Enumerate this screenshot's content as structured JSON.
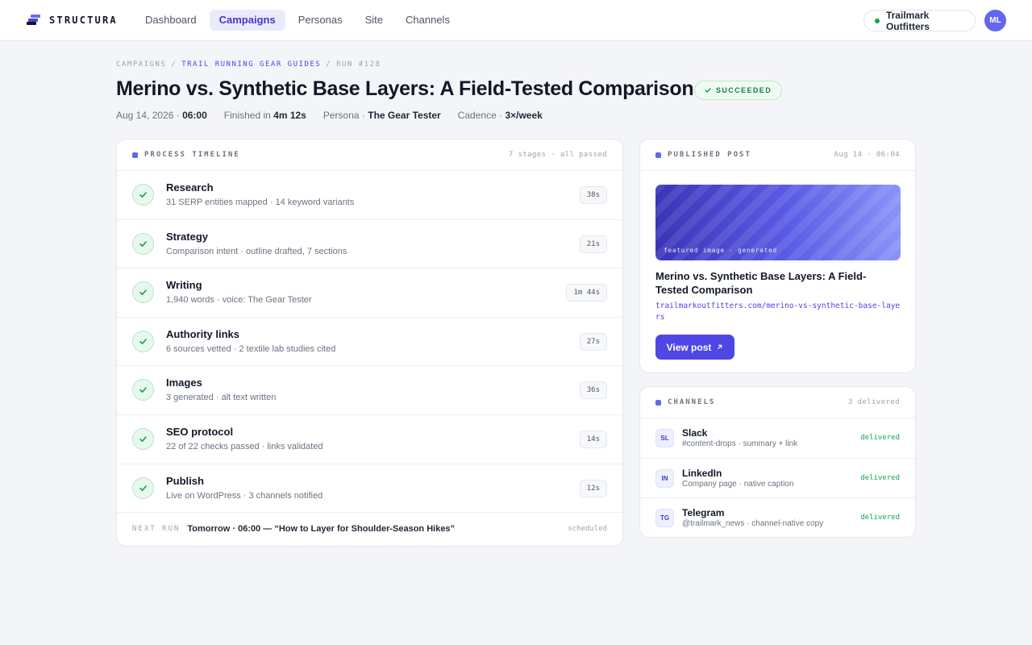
{
  "app": {
    "name": "STRUCTURA"
  },
  "nav": [
    "Dashboard",
    "Campaigns",
    "Personas",
    "Site",
    "Channels"
  ],
  "nav_active": "Campaigns",
  "org": {
    "name": "Trailmark Outfitters"
  },
  "user": {
    "initials": "ML"
  },
  "breadcrumb": {
    "root": "CAMPAIGNS",
    "campaign": "TRAIL RUNNING GEAR GUIDES",
    "run": "RUN #128",
    "sep": "/"
  },
  "title": "Merino vs. Synthetic Base Layers: A Field-Tested Comparison",
  "status": "SUCCEEDED",
  "meta": {
    "date": "Aug 14, 2026 ·",
    "time": "06:00",
    "finished_label": "Finished in",
    "finished_value": "4m 12s",
    "persona_label": "Persona ·",
    "persona_value": "The Gear Tester",
    "cadence_label": "Cadence ·",
    "cadence_value": "3×/week"
  },
  "timeline": {
    "title": "PROCESS TIMELINE",
    "summary": "7 stages · all passed",
    "stages": [
      {
        "name": "Research",
        "detail": "31 SERP entities mapped · 14 keyword variants",
        "duration": "38s"
      },
      {
        "name": "Strategy",
        "detail": "Comparison intent · outline drafted, 7 sections",
        "duration": "21s"
      },
      {
        "name": "Writing",
        "detail": "1,940 words · voice: The Gear Tester",
        "duration": "1m 44s"
      },
      {
        "name": "Authority links",
        "detail": "6 sources vetted · 2 textile lab studies cited",
        "duration": "27s"
      },
      {
        "name": "Images",
        "detail": "3 generated · alt text written",
        "duration": "36s"
      },
      {
        "name": "SEO protocol",
        "detail": "22 of 22 checks passed · links validated",
        "duration": "14s"
      },
      {
        "name": "Publish",
        "detail": "Live on WordPress · 3 channels notified",
        "duration": "12s"
      }
    ],
    "next_run": {
      "label": "NEXT RUN",
      "value": "Tomorrow · 06:00 — “How to Layer for Shoulder-Season Hikes”",
      "status": "scheduled"
    }
  },
  "post": {
    "title": "PUBLISHED POST",
    "timestamp": "Aug 14 · 06:04",
    "image_caption": "featured image · generated",
    "post_title": "Merino vs. Synthetic Base Layers: A Field-Tested Comparison",
    "url": "trailmarkoutfitters.com/merino-vs-synthetic-base-layers",
    "button": "View post"
  },
  "channels": {
    "title": "CHANNELS",
    "summary": "3 delivered",
    "items": [
      {
        "badge": "SL",
        "name": "Slack",
        "detail": "#content-drops · summary + link",
        "status": "delivered"
      },
      {
        "badge": "IN",
        "name": "LinkedIn",
        "detail": "Company page · native caption",
        "status": "delivered"
      },
      {
        "badge": "TG",
        "name": "Telegram",
        "detail": "@trailmark_news · channel-native copy",
        "status": "delivered"
      }
    ]
  },
  "colors": {
    "accent": "#4f46e5",
    "success": "#16a34a",
    "background": "#f4f5f8"
  }
}
